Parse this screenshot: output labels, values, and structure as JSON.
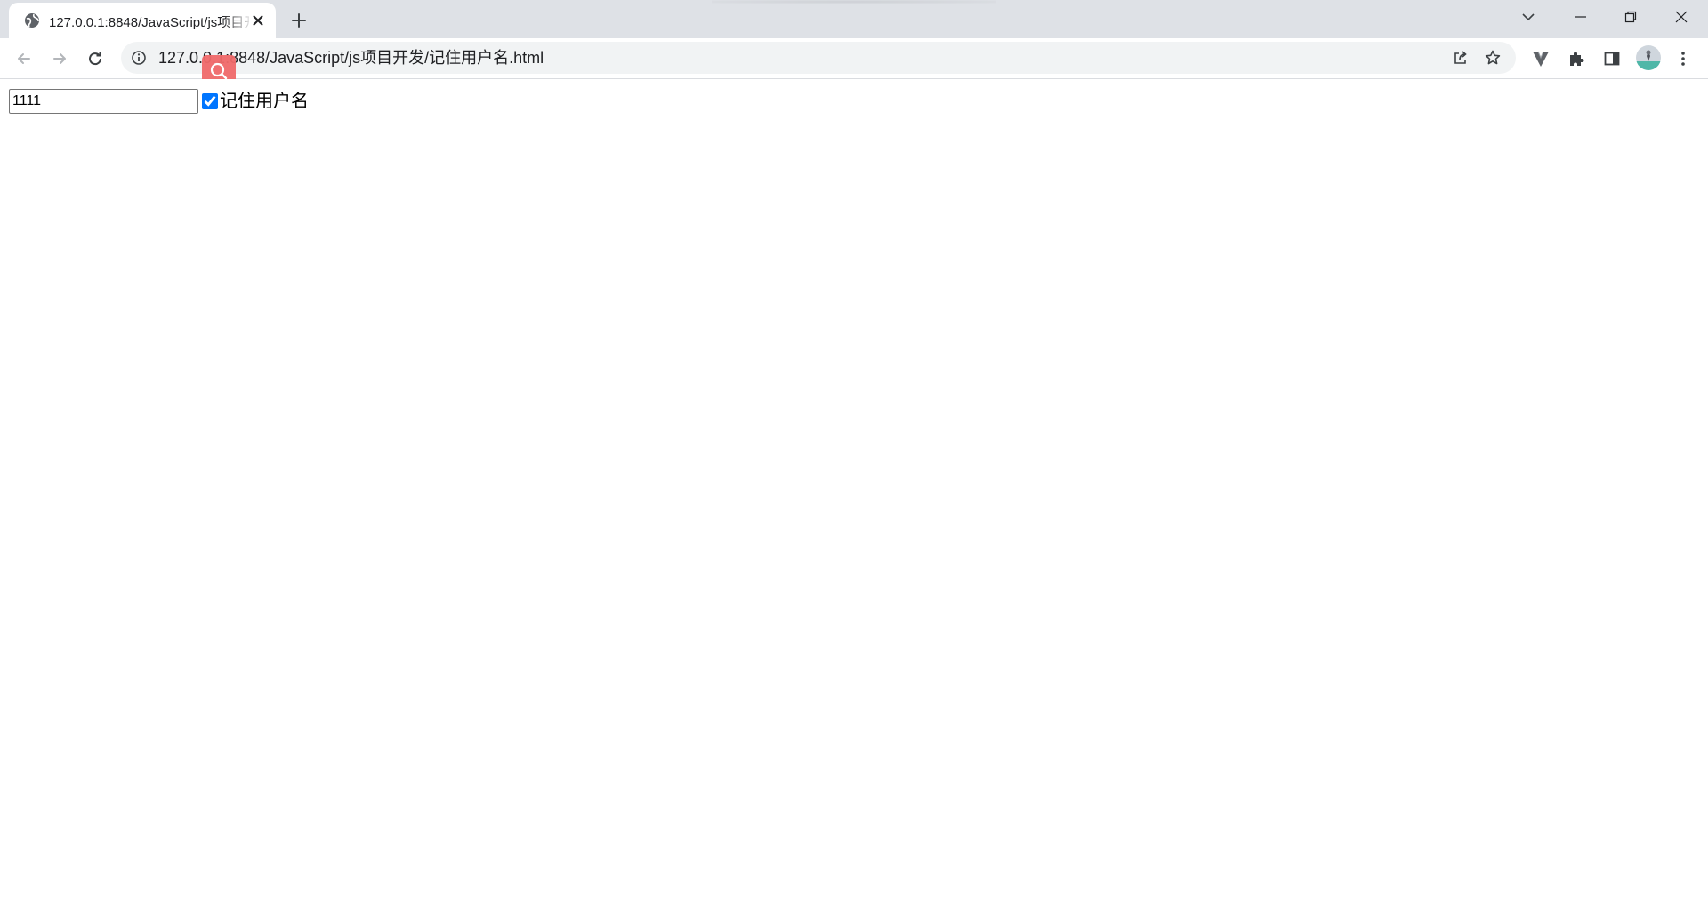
{
  "browser": {
    "tab": {
      "title": "127.0.0.1:8848/JavaScript/js项目开发/记住用户名.html",
      "favicon": "globe-icon"
    },
    "address_bar": {
      "url": "127.0.0.1:8848/JavaScript/js项目开发/记住用户名.html"
    },
    "icons": {
      "back": "arrow-left-icon",
      "forward": "arrow-right-icon",
      "reload": "reload-icon",
      "site_info": "info-icon",
      "share": "share-icon",
      "bookmark": "star-icon",
      "extension": "v-extension-icon",
      "extensions": "puzzle-icon",
      "side_panel": "side-panel-icon",
      "menu": "kebab-menu-icon",
      "tab_search": "chevron-down-icon",
      "minimize": "minimize-icon",
      "maximize": "restore-icon",
      "close": "close-icon",
      "search_overlay": "magnifier-icon"
    },
    "colors": {
      "tabstrip": "#dee1e6",
      "omnibox": "#f1f3f4",
      "search_overlay": "#f06a6a",
      "checkbox_accent": "#0075ff"
    }
  },
  "page": {
    "username_input": {
      "value": "1111"
    },
    "remember_checkbox": {
      "checked": true,
      "label": "记住用户名"
    }
  }
}
